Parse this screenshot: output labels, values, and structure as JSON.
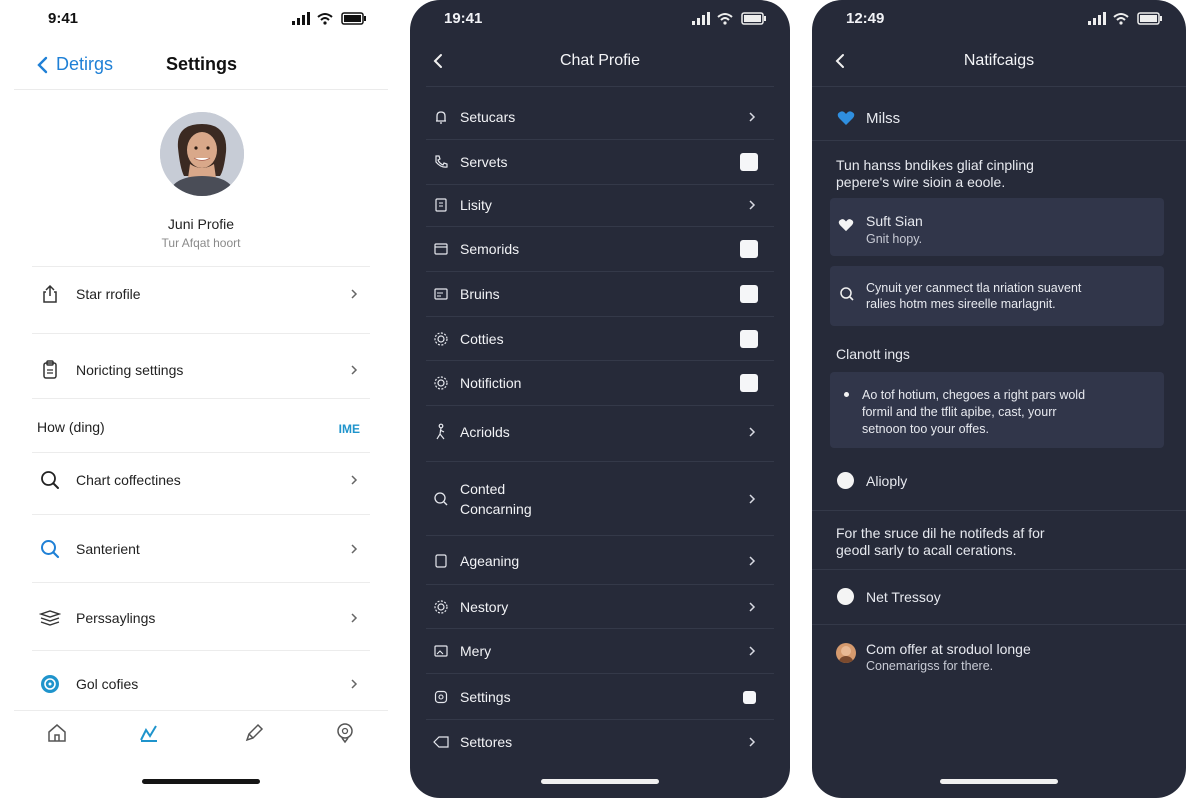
{
  "screen1": {
    "status_time": "9:41",
    "nav": {
      "back_label": "Detirgs",
      "title": "Settings"
    },
    "profile": {
      "name": "Juni Profie",
      "subtitle": "Tur Afqat hoort"
    },
    "rows_top": [
      {
        "label": "Star rrofile",
        "icon": "share-icon"
      },
      {
        "label": "Noricting settings",
        "icon": "clipboard-icon"
      }
    ],
    "section": {
      "label": "How (ding)",
      "action": "IME"
    },
    "rows_bottom": [
      {
        "label": "Chart coffectines",
        "icon": "search-icon"
      },
      {
        "label": "Santerient",
        "icon": "search-icon"
      },
      {
        "label": "Perssaylings",
        "icon": "stack-icon"
      },
      {
        "label": "Gol cofies",
        "icon": "help-circle-icon"
      }
    ],
    "tabbar": [
      "home-icon",
      "chart-icon",
      "pen-icon",
      "location-icon"
    ],
    "accent": "#1f80d6"
  },
  "screen2": {
    "status_time": "19:41",
    "title": "Chat Profie",
    "rows": [
      {
        "label": "Setucars",
        "control": "chevron",
        "icon": "bell-icon"
      },
      {
        "label": "Servets",
        "control": "checkbox",
        "icon": "phone-icon"
      },
      {
        "label": "Lisity",
        "control": "chevron",
        "icon": "document-icon"
      },
      {
        "label": "Semorids",
        "control": "checkbox",
        "icon": "card-icon"
      },
      {
        "label": "Bruins",
        "control": "checkbox",
        "icon": "card-icon"
      },
      {
        "label": "Cotties",
        "control": "checkbox",
        "icon": "gear-icon"
      },
      {
        "label": "Notifiction",
        "control": "checkbox",
        "icon": "gear-icon"
      },
      {
        "label": "Acriolds",
        "control": "chevron",
        "icon": "walk-icon"
      },
      {
        "label": "Conted\nConcarning",
        "control": "chevron",
        "icon": "search-icon"
      },
      {
        "label": "Ageaning",
        "control": "chevron",
        "icon": "tablet-icon"
      },
      {
        "label": "Nestory",
        "control": "chevron",
        "icon": "gear-icon"
      },
      {
        "label": "Mery",
        "control": "chevron",
        "icon": "image-icon"
      },
      {
        "label": "Settings",
        "control": "checkbox-small",
        "icon": "settings-icon"
      },
      {
        "label": "Settores",
        "control": "chevron",
        "icon": "tag-icon"
      }
    ],
    "background": "#262a39"
  },
  "screen3": {
    "status_time": "12:49",
    "title": "Natifcaigs",
    "heart_title": "Milss",
    "intro": [
      "Tun hanss bndikes gliaf cinpling",
      "pepere's wire sioin a eoole."
    ],
    "card1": {
      "title": "Suft Sian",
      "subtitle": "Gnit hopy."
    },
    "card2": [
      "Cynuit yer canmect tla nriation suavent",
      "ralies hotm mes sireelle marlagnit."
    ],
    "section": "Clanott ings",
    "card3": [
      "Ao tof hotium, chegoes a right pars wold",
      "formil and the tflit apibe, cast, yourr",
      "setnoon too your offes."
    ],
    "radio1": "Alioply",
    "text2": [
      "For the sruce dil he notifeds af for",
      "geodl sarly to acall cerations."
    ],
    "radio2": "Net Tressoy",
    "footer": {
      "title": "Com offer at sroduol longe",
      "subtitle": "Conemarigss for there."
    }
  }
}
